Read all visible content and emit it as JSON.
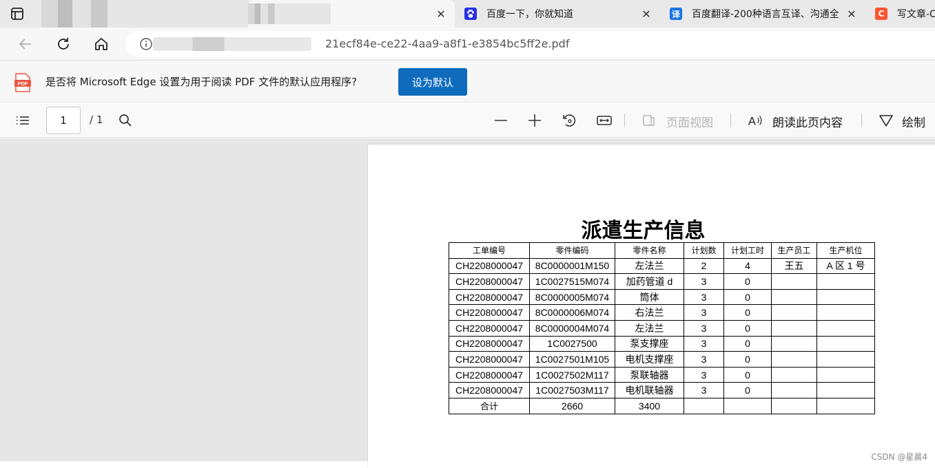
{
  "tabs": [
    {
      "title": "",
      "blurred": true,
      "active": false
    },
    {
      "title": "",
      "blurred": true,
      "active": true
    },
    {
      "title": "百度一下，你就知道",
      "icon": "baidu-paw-icon",
      "color": "#2932e1"
    },
    {
      "title": "百度翻译-200种语言互译、沟通全",
      "icon": "translate-icon",
      "icon_text": "译",
      "color": "#1a73e8"
    },
    {
      "title": "写文章-C",
      "icon": "csdn-icon",
      "icon_text": "C",
      "color": "#fc5531"
    }
  ],
  "close_glyph": "✕",
  "address": {
    "url_suffix": "21ecf84e-ce22-4aa9-a8f1-e3854bc5ff2e.pdf"
  },
  "infobar": {
    "badge_text": "PDF",
    "message": "是否将 Microsoft Edge 设置为用于阅读 PDF 文件的默认应用程序?",
    "button_label": "设为默认"
  },
  "pdf_toolbar": {
    "page_current": "1",
    "page_total": "/ 1",
    "page_view_label": "页面视图",
    "read_aloud_label": "朗读此页内容",
    "draw_label": "绘制"
  },
  "document": {
    "title": "派遣生产信息",
    "columns": [
      "工单编号",
      "零件编码",
      "零件名称",
      "计划数",
      "计划工时",
      "生产员工",
      "生产机位"
    ],
    "rows": [
      [
        "CH2208000047",
        "8C0000001M150",
        "左法兰",
        "2",
        "4",
        "王五",
        "A 区 1 号"
      ],
      [
        "CH2208000047",
        "1C0027515M074",
        "加药管道 d",
        "3",
        "0",
        "",
        ""
      ],
      [
        "CH2208000047",
        "8C0000005M074",
        "筒体",
        "3",
        "0",
        "",
        ""
      ],
      [
        "CH2208000047",
        "8C0000006M074",
        "右法兰",
        "3",
        "0",
        "",
        ""
      ],
      [
        "CH2208000047",
        "8C0000004M074",
        "左法兰",
        "3",
        "0",
        "",
        ""
      ],
      [
        "CH2208000047",
        "1C0027500",
        "泵支撑座",
        "3",
        "0",
        "",
        ""
      ],
      [
        "CH2208000047",
        "1C0027501M105",
        "电机支撑座",
        "3",
        "0",
        "",
        ""
      ],
      [
        "CH2208000047",
        "1C0027502M117",
        "泵联轴器",
        "3",
        "0",
        "",
        ""
      ],
      [
        "CH2208000047",
        "1C0027503M117",
        "电机联轴器",
        "3",
        "0",
        "",
        ""
      ]
    ],
    "total_row": [
      "合计",
      "2660",
      "3400",
      "",
      "",
      "",
      ""
    ]
  },
  "watermark": "CSDN @星晨4",
  "colors": {
    "primary_button": "#0f6cbd",
    "pdf_badge": "#e8543f",
    "viewer_background": "#e6e6e6"
  }
}
